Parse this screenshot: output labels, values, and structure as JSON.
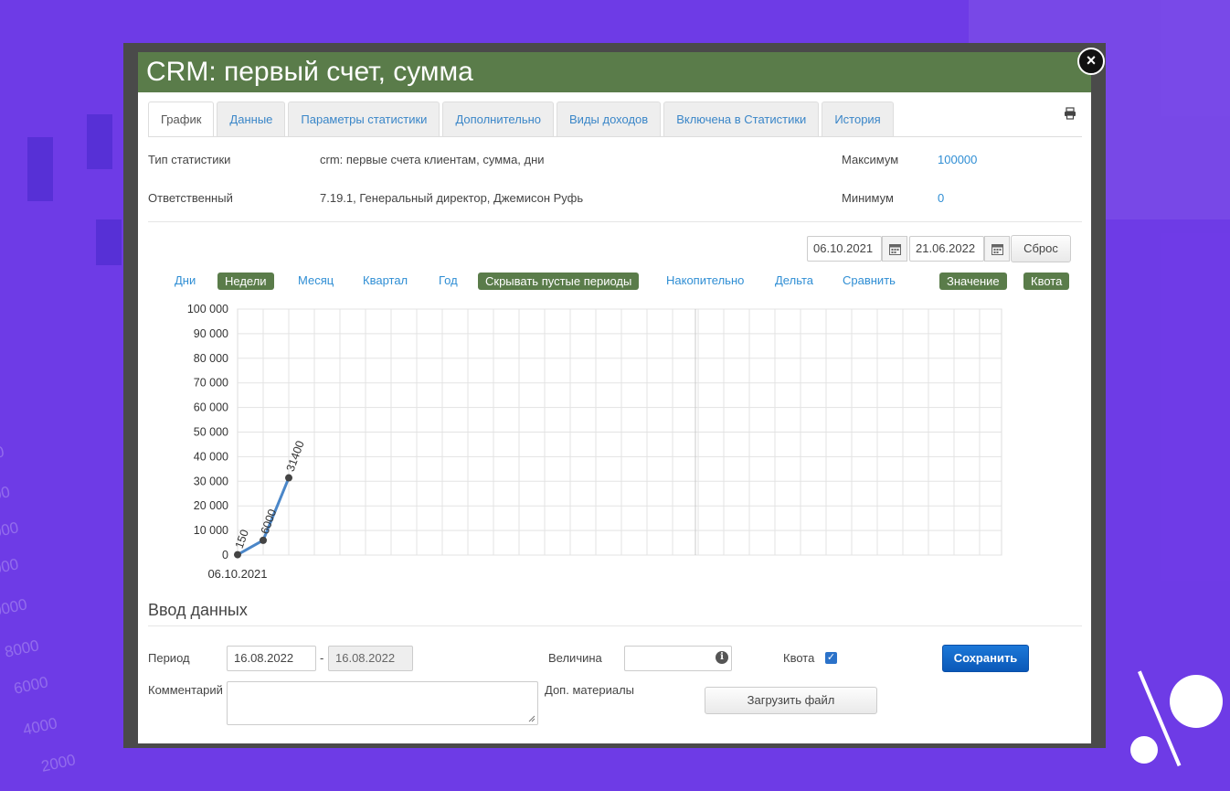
{
  "window": {
    "title": "CRM: первый счет, сумма"
  },
  "tabs": [
    {
      "label": "График",
      "active": true
    },
    {
      "label": "Данные"
    },
    {
      "label": "Параметры статистики"
    },
    {
      "label": "Дополнительно"
    },
    {
      "label": "Виды доходов"
    },
    {
      "label": "Включена в Статистики"
    },
    {
      "label": "История"
    }
  ],
  "info": {
    "type_label": "Тип статистики",
    "type_value": "crm: первые счета клиентам, сумма, дни",
    "resp_label": "Ответственный",
    "resp_value": "7.19.1, Генеральный директор, Джемисон Руфь",
    "max_label": "Максимум",
    "max_value": "100000",
    "min_label": "Минимум",
    "min_value": "0"
  },
  "range": {
    "from": "06.10.2021",
    "to": "21.06.2022",
    "reset_label": "Сброс"
  },
  "periods": {
    "days": "Дни",
    "weeks": "Недели",
    "month": "Месяц",
    "quarter": "Квартал",
    "year": "Год",
    "hide_empty": "Скрывать пустые периоды",
    "cumulative": "Накопительно",
    "delta": "Дельта",
    "compare": "Сравнить",
    "value": "Значение",
    "quota": "Квота"
  },
  "chart_data": {
    "type": "line",
    "x": [
      "06.10.2021",
      "",
      ""
    ],
    "values": [
      150,
      6000,
      31400
    ],
    "point_labels": [
      "150",
      "6000",
      "31400"
    ],
    "xtick_labels": [
      "06.10.2021"
    ],
    "ylim": [
      0,
      100000
    ],
    "yticks": [
      "0",
      "10 000",
      "20 000",
      "30 000",
      "40 000",
      "50 000",
      "60 000",
      "70 000",
      "80 000",
      "90 000",
      "100 000"
    ],
    "grid": true,
    "line_color": "#4a86c8",
    "title": "",
    "xlabel": "",
    "ylabel": ""
  },
  "entry": {
    "section_title": "Ввод данных",
    "period_label": "Период",
    "period_from": "16.08.2022",
    "period_dash": "-",
    "period_to": "16.08.2022",
    "value_label": "Величина",
    "value_input": "",
    "quota_label": "Квота",
    "quota_checked": true,
    "save_label": "Сохранить",
    "comment_label": "Комментарий",
    "materials_label": "Доп. материалы",
    "upload_label": "Загрузить файл"
  },
  "colors": {
    "accent_green": "#5a7c4a",
    "link_blue": "#2f8ed4",
    "primary_blue": "#0a58b8"
  }
}
